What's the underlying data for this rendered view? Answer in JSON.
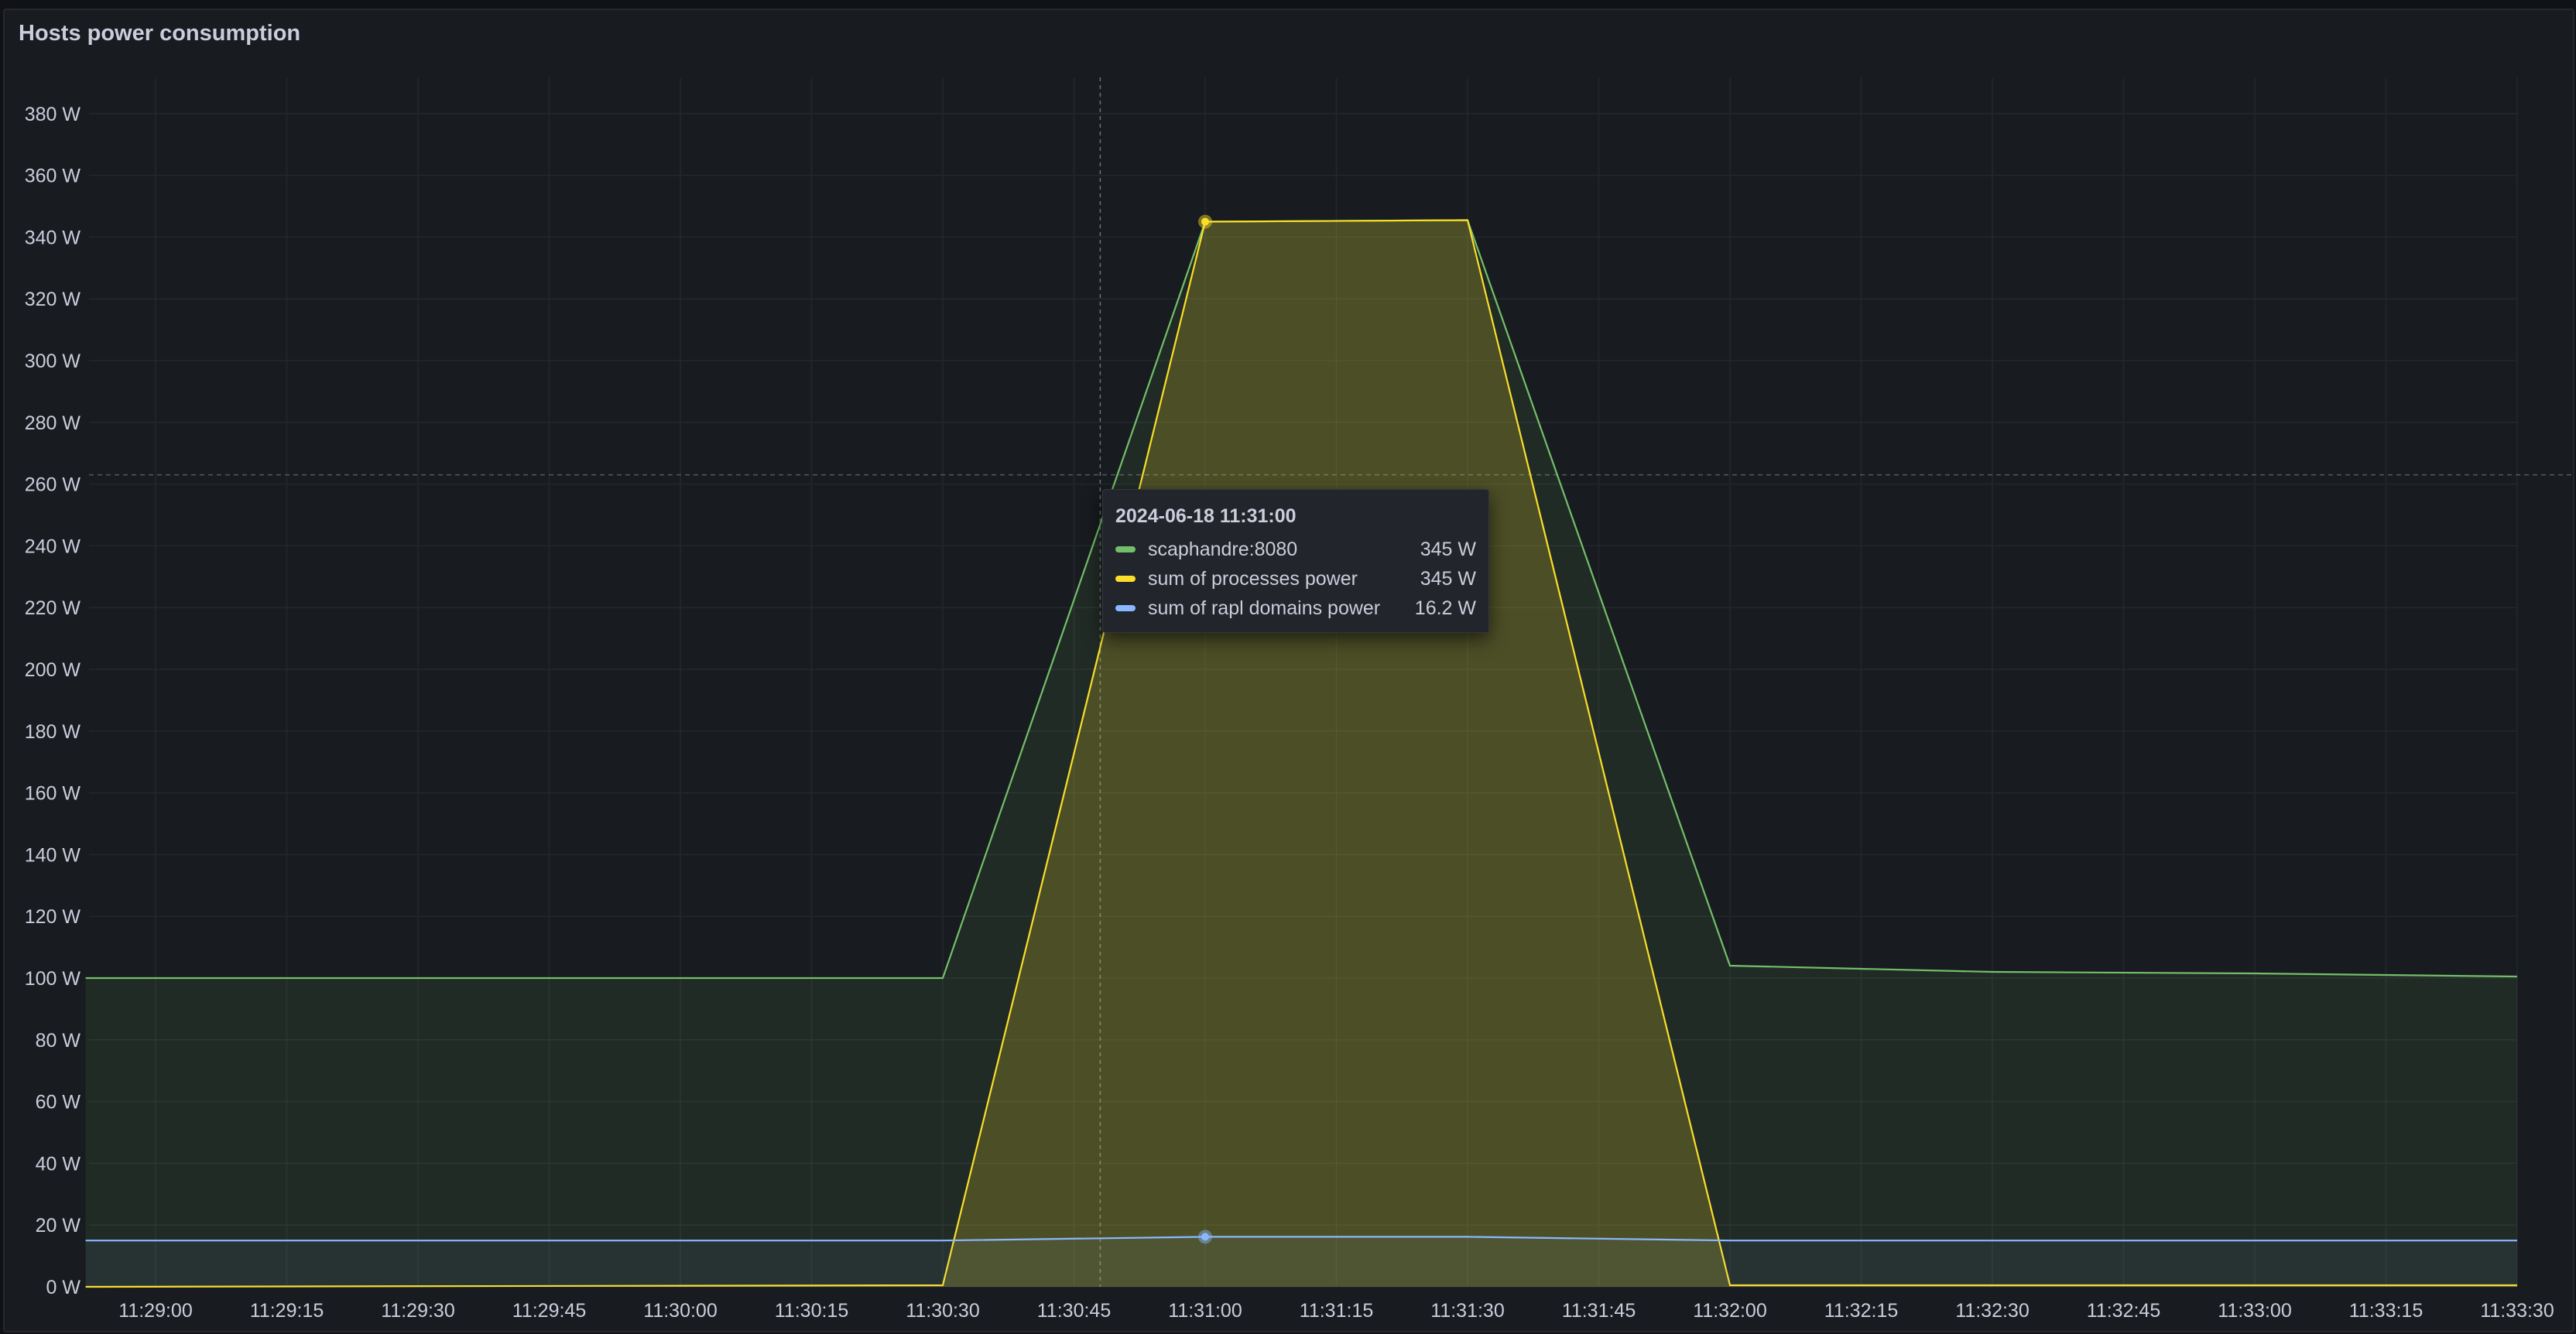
{
  "panel": {
    "title": "Hosts power consumption"
  },
  "tooltip": {
    "time": "2024-06-18 11:31:00",
    "rows": [
      {
        "name": "scaphandre:8080",
        "value": "345 W",
        "color": "#73bf69"
      },
      {
        "name": "sum of processes power",
        "value": "345 W",
        "color": "#fade2a"
      },
      {
        "name": "sum of rapl domains power",
        "value": "16.2 W",
        "color": "#8ab8ff"
      }
    ]
  },
  "colors": {
    "background": "#181b1f",
    "grid": "#24272c",
    "axis_text": "#ccccdc",
    "threshold_line": "#555860"
  },
  "chart_data": {
    "type": "area",
    "title": "Hosts power consumption",
    "xlabel": "",
    "ylabel": "",
    "ylim": [
      0,
      390
    ],
    "x_range": [
      "11:28:52",
      "11:33:30"
    ],
    "y_ticks": [
      "0 W",
      "20 W",
      "40 W",
      "60 W",
      "80 W",
      "100 W",
      "120 W",
      "140 W",
      "160 W",
      "180 W",
      "200 W",
      "220 W",
      "240 W",
      "260 W",
      "280 W",
      "300 W",
      "320 W",
      "340 W",
      "360 W",
      "380 W"
    ],
    "y_tick_values": [
      0,
      20,
      40,
      60,
      80,
      100,
      120,
      140,
      160,
      180,
      200,
      220,
      240,
      260,
      280,
      300,
      320,
      340,
      360,
      380
    ],
    "x_ticks": [
      "11:29:00",
      "11:29:15",
      "11:29:30",
      "11:29:45",
      "11:30:00",
      "11:30:15",
      "11:30:30",
      "11:30:45",
      "11:31:00",
      "11:31:15",
      "11:31:30",
      "11:31:45",
      "11:32:00",
      "11:32:15",
      "11:32:30",
      "11:32:45",
      "11:33:00",
      "11:33:15",
      "11:33:30"
    ],
    "grid": true,
    "legend": "none",
    "dashed_reference_y": 263,
    "hover_time": "11:30:48",
    "series": [
      {
        "name": "scaphandre:8080",
        "color": "#73bf69",
        "points": [
          [
            "11:28:52",
            100
          ],
          [
            "11:30:30",
            100
          ],
          [
            "11:31:00",
            345
          ],
          [
            "11:31:30",
            345.5
          ],
          [
            "11:32:00",
            104
          ],
          [
            "11:32:30",
            102
          ],
          [
            "11:33:00",
            101.5
          ],
          [
            "11:33:30",
            100.5
          ]
        ]
      },
      {
        "name": "sum of processes power",
        "color": "#fade2a",
        "points": [
          [
            "11:28:52",
            0
          ],
          [
            "11:30:30",
            0.5
          ],
          [
            "11:31:00",
            345
          ],
          [
            "11:31:30",
            345.5
          ],
          [
            "11:32:00",
            0.5
          ],
          [
            "11:33:30",
            0.5
          ]
        ]
      },
      {
        "name": "sum of rapl domains power",
        "color": "#8ab8ff",
        "points": [
          [
            "11:28:52",
            15
          ],
          [
            "11:30:30",
            15
          ],
          [
            "11:31:00",
            16.2
          ],
          [
            "11:31:30",
            16.2
          ],
          [
            "11:32:00",
            15
          ],
          [
            "11:33:30",
            15
          ]
        ]
      }
    ],
    "highlight": {
      "time": "11:31:00",
      "values": [
        345,
        345,
        16.2
      ]
    }
  }
}
